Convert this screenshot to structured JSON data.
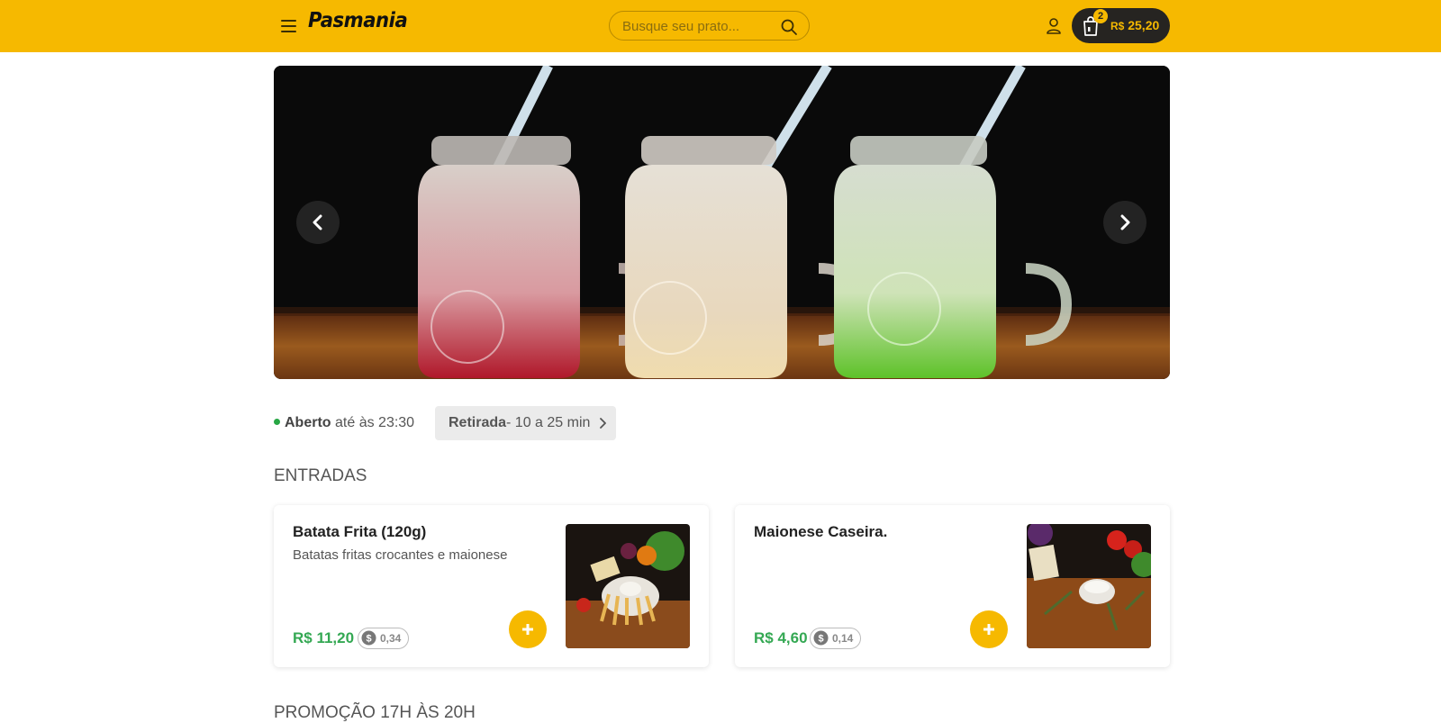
{
  "header": {
    "logo": "Pasmania",
    "search_placeholder": "Busque seu prato...",
    "cart": {
      "count": "2",
      "currency": "R$",
      "total": "25,20"
    }
  },
  "status": {
    "open_label": "Aberto",
    "hours_text": " até às 23:30",
    "pickup_label": "Retirada",
    "pickup_time": "- 10 a 25 min"
  },
  "sections": {
    "entradas": "ENTRADAS",
    "promo": "PROMOÇÃO 17H ÀS 20H"
  },
  "products": [
    {
      "name": "Batata Frita (120g)",
      "description": "Batatas fritas crocantes e maionese",
      "price": "R$ 11,20",
      "cashback": "0,34"
    },
    {
      "name": "Maionese Caseira.",
      "description": "",
      "price": "R$ 4,60",
      "cashback": "0,14"
    }
  ],
  "icons": {
    "menu": "hamburger-icon",
    "search": "search-icon",
    "user": "user-icon",
    "cart": "shopping-bag-icon",
    "prev": "chevron-left-icon",
    "next": "chevron-right-icon",
    "pickup": "chevron-right-icon",
    "cashback": "coin-icon",
    "add": "plus-icon"
  },
  "colors": {
    "brand": "#f6b900",
    "cart_bg": "#262421",
    "price": "#34a853",
    "open_dot": "#28a745"
  }
}
